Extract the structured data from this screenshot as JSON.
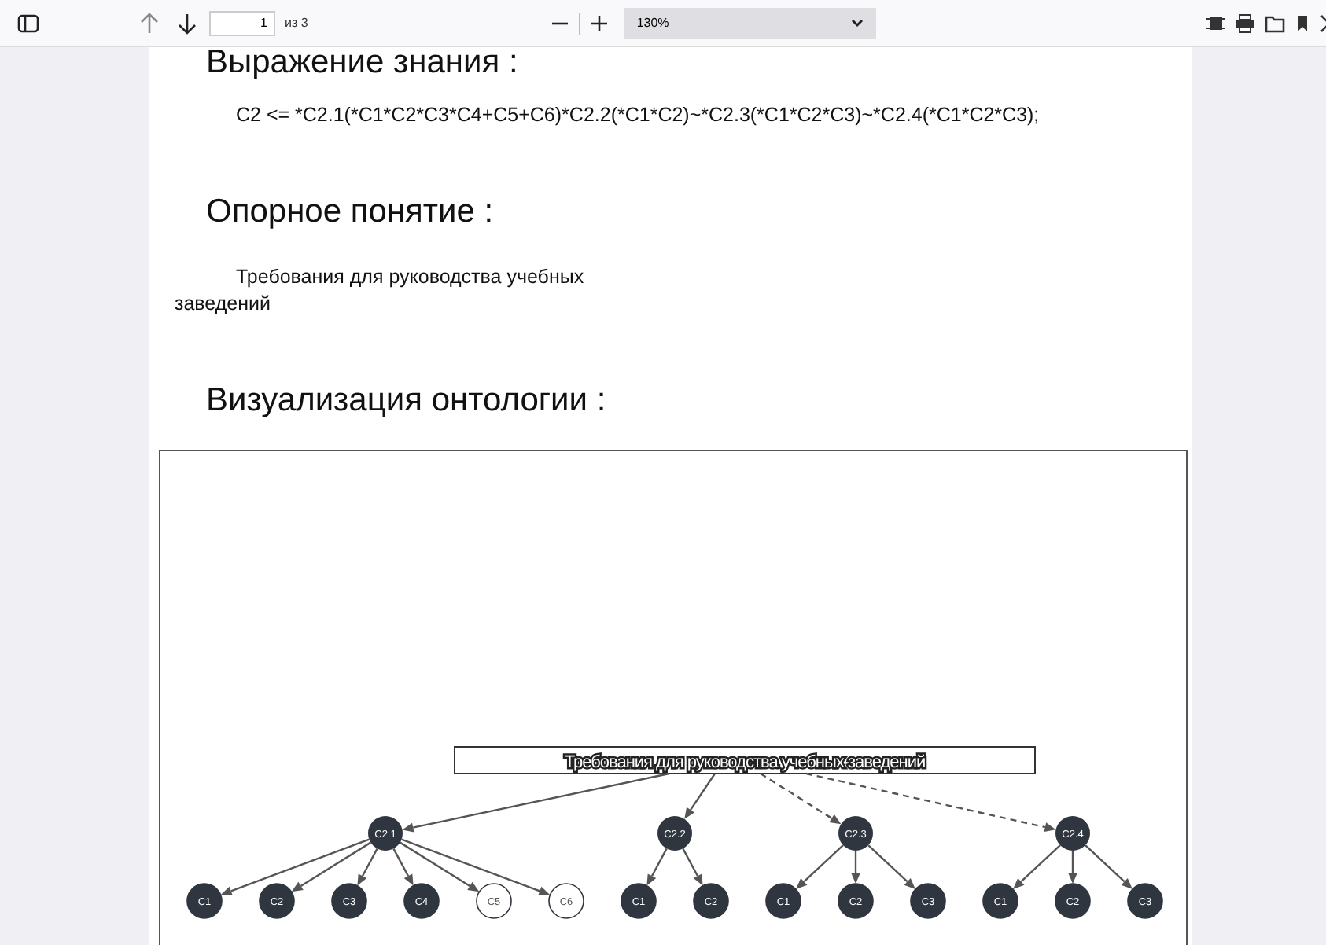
{
  "toolbar": {
    "page": "1",
    "page_total": "из 3",
    "zoom": "130%"
  },
  "sections": [
    {
      "heading": "Выражение знания :",
      "text": "C2 <= *C2.1(*C1*C2*C3*C4+C5+C6)*C2.2(*C1*C2)~*C2.3(*C1*C2*C3)~*C2.4(*C1*C2*C3);",
      "kind": "formula"
    },
    {
      "heading": "Опорное понятие :",
      "text": "Требования для руководства учебных заведений",
      "kind": "paragraph"
    },
    {
      "heading": "Визуализация онтологии :",
      "kind": "diagram"
    }
  ],
  "ontology": {
    "label": "Требования для руководства учебных заведений",
    "children": [
      {
        "label": "C2.1",
        "dashed": false,
        "children": [
          {
            "label": "C1",
            "filled": true
          },
          {
            "label": "C2",
            "filled": true
          },
          {
            "label": "C3",
            "filled": true
          },
          {
            "label": "C4",
            "filled": true
          },
          {
            "label": "C5",
            "filled": false
          },
          {
            "label": "C6",
            "filled": false
          }
        ]
      },
      {
        "label": "C2.2",
        "dashed": false,
        "children": [
          {
            "label": "C1",
            "filled": true
          },
          {
            "label": "C2",
            "filled": true
          }
        ]
      },
      {
        "label": "C2.3",
        "dashed": true,
        "children": [
          {
            "label": "C1",
            "filled": true
          },
          {
            "label": "C2",
            "filled": true
          },
          {
            "label": "C3",
            "filled": true
          }
        ]
      },
      {
        "label": "C2.4",
        "dashed": true,
        "children": [
          {
            "label": "C1",
            "filled": true
          },
          {
            "label": "C2",
            "filled": true
          },
          {
            "label": "C3",
            "filled": true
          }
        ]
      }
    ]
  }
}
